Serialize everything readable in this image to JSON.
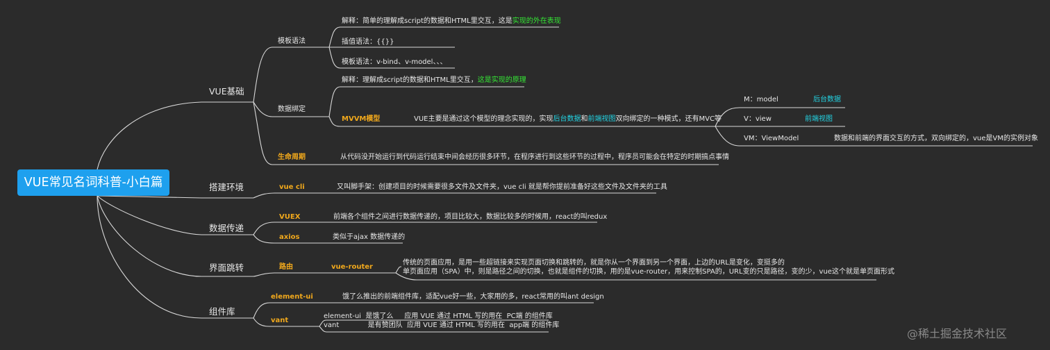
{
  "root": "VUE常见名词科普-小白篇",
  "watermark": "@稀土掘金技术社区",
  "colors": {
    "background": "#2b2b2b",
    "root": "#1ea0ee",
    "line": "#d8d8d8",
    "orange": "#f0a81c",
    "green": "#34e834",
    "cyan": "#23d3e3"
  },
  "b1": {
    "label": "VUE基础",
    "tpl": {
      "label": "模板语法",
      "l1a": "解释：简单的理解成script的数据和HTML里交互，这是",
      "l1b": "实现的外在表现",
      "l2": "插值语法：{{}}",
      "l3": "模板语法：v-bind、v-model、、、"
    },
    "bind": {
      "label": "数据绑定",
      "l1a": "解释：理解成script的数据和HTML里交互，",
      "l1b": "这是实现的原理",
      "mvvm": {
        "label": "MVVM模型",
        "da": "VUE主要是通过这个模型的理念实现的，实现",
        "db": "后台数据",
        "dc": "和",
        "dd": "前端视图",
        "de": "双向绑定的一种模式，还有MVC等"
      },
      "m": {
        "label": "M：model",
        "note": "后台数据"
      },
      "v": {
        "label": "V：view",
        "note": "前端视图"
      },
      "vm": {
        "label": "VM：ViewModel",
        "note": "数据和前端的界面交互的方式，双向绑定的，vue是VM的实例对象"
      }
    },
    "life": {
      "label": "生命周期",
      "desc": "从代码没开始运行到代码运行结束中间会经历很多环节，在程序进行到这些环节的过程中，程序员可能会在特定的时期搞点事情"
    }
  },
  "b2": {
    "label": "搭建环境",
    "cli": {
      "label": "vue cli",
      "desc": "又叫脚手架：创建项目的时候需要很多文件及文件夹，vue cli 就是帮你提前准备好这些文件及文件夹的工具"
    }
  },
  "b3": {
    "label": "数据传递",
    "vuex": {
      "label": "VUEX",
      "desc": "前端各个组件之间进行数据传递的，项目比较大，数据比较多的时候用，react的叫redux"
    },
    "axios": {
      "label": "axios",
      "desc": "类似于ajax 数据传递的"
    }
  },
  "b4": {
    "label": "界面跳转",
    "route": {
      "label": "路由",
      "sub": "vue-router",
      "d1": "传统的页面应用，是用一些超链接来实现页面切换和跳转的，就是你从一个界面到另一个界面，上边的URL是变化，变挺多的",
      "d2": "单页面应用（SPA）中，则是路径之间的切换，也就是组件的切换，用的是vue-router，用来控制SPA的，URL变的只是路径，变的少，vue这个就是单页面形式"
    }
  },
  "b5": {
    "label": "组件库",
    "eui": {
      "label": "element-ui",
      "desc": "饿了么推出的前端组件库，适配vue好一些，大家用的多，react常用的叫ant design"
    },
    "vant": {
      "label": "vant",
      "r1": "element-ui  是饿了么     应用 VUE 通过 HTML 写的用在  PC端 的组件库",
      "r2": "vant             是有赞团队  应用 VUE 通过 HTML 写的用在  app端 的组件库"
    }
  }
}
